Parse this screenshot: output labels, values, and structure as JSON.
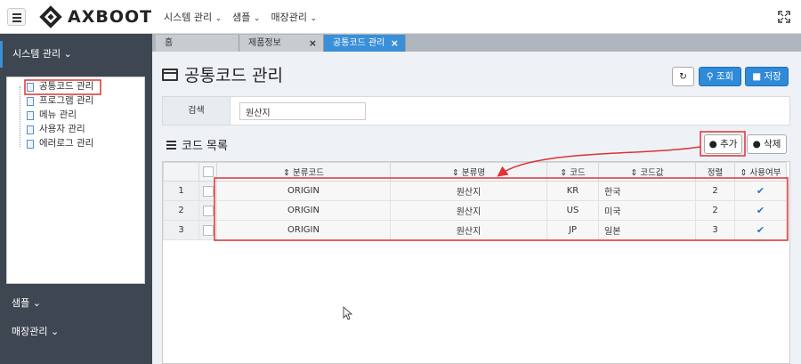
{
  "app": {
    "logo_text": "AXBOOT"
  },
  "topmenu": [
    {
      "label": "시스템 관리"
    },
    {
      "label": "샘플"
    },
    {
      "label": "매장관리"
    }
  ],
  "sidebar": {
    "groups": [
      {
        "label": "시스템 관리"
      },
      {
        "label": "샘플"
      },
      {
        "label": "매장관리"
      }
    ],
    "items": [
      {
        "label": "공통코드 관리"
      },
      {
        "label": "프로그램 관리"
      },
      {
        "label": "메뉴 관리"
      },
      {
        "label": "사용자 관리"
      },
      {
        "label": "에러로그 관리"
      }
    ]
  },
  "tabs": [
    {
      "label": "홈"
    },
    {
      "label": "제품정보"
    },
    {
      "label": "공통코드 관리"
    }
  ],
  "page": {
    "title": "공통코드 관리",
    "search_label": "조회",
    "save_label": "저장"
  },
  "search": {
    "label": "검색",
    "value": "원산지"
  },
  "section": {
    "title": "코드 목록",
    "add_label": "추가",
    "delete_label": "삭제"
  },
  "grid": {
    "columns": [
      "분류코드",
      "분류명",
      "코드",
      "코드값",
      "정렬",
      "사용여부"
    ],
    "rows": [
      {
        "num": "1",
        "group_code": "ORIGIN",
        "group_name": "원산지",
        "code": "KR",
        "code_value": "한국",
        "sort": "2",
        "use": true
      },
      {
        "num": "2",
        "group_code": "ORIGIN",
        "group_name": "원산지",
        "code": "US",
        "code_value": "미국",
        "sort": "2",
        "use": true
      },
      {
        "num": "3",
        "group_code": "ORIGIN",
        "group_name": "원산지",
        "code": "JP",
        "code_value": "일본",
        "sort": "3",
        "use": true
      }
    ]
  },
  "colors": {
    "accent": "#3a8fd8",
    "sidebar_bg": "#3e4651",
    "annotation": "#d33333"
  }
}
